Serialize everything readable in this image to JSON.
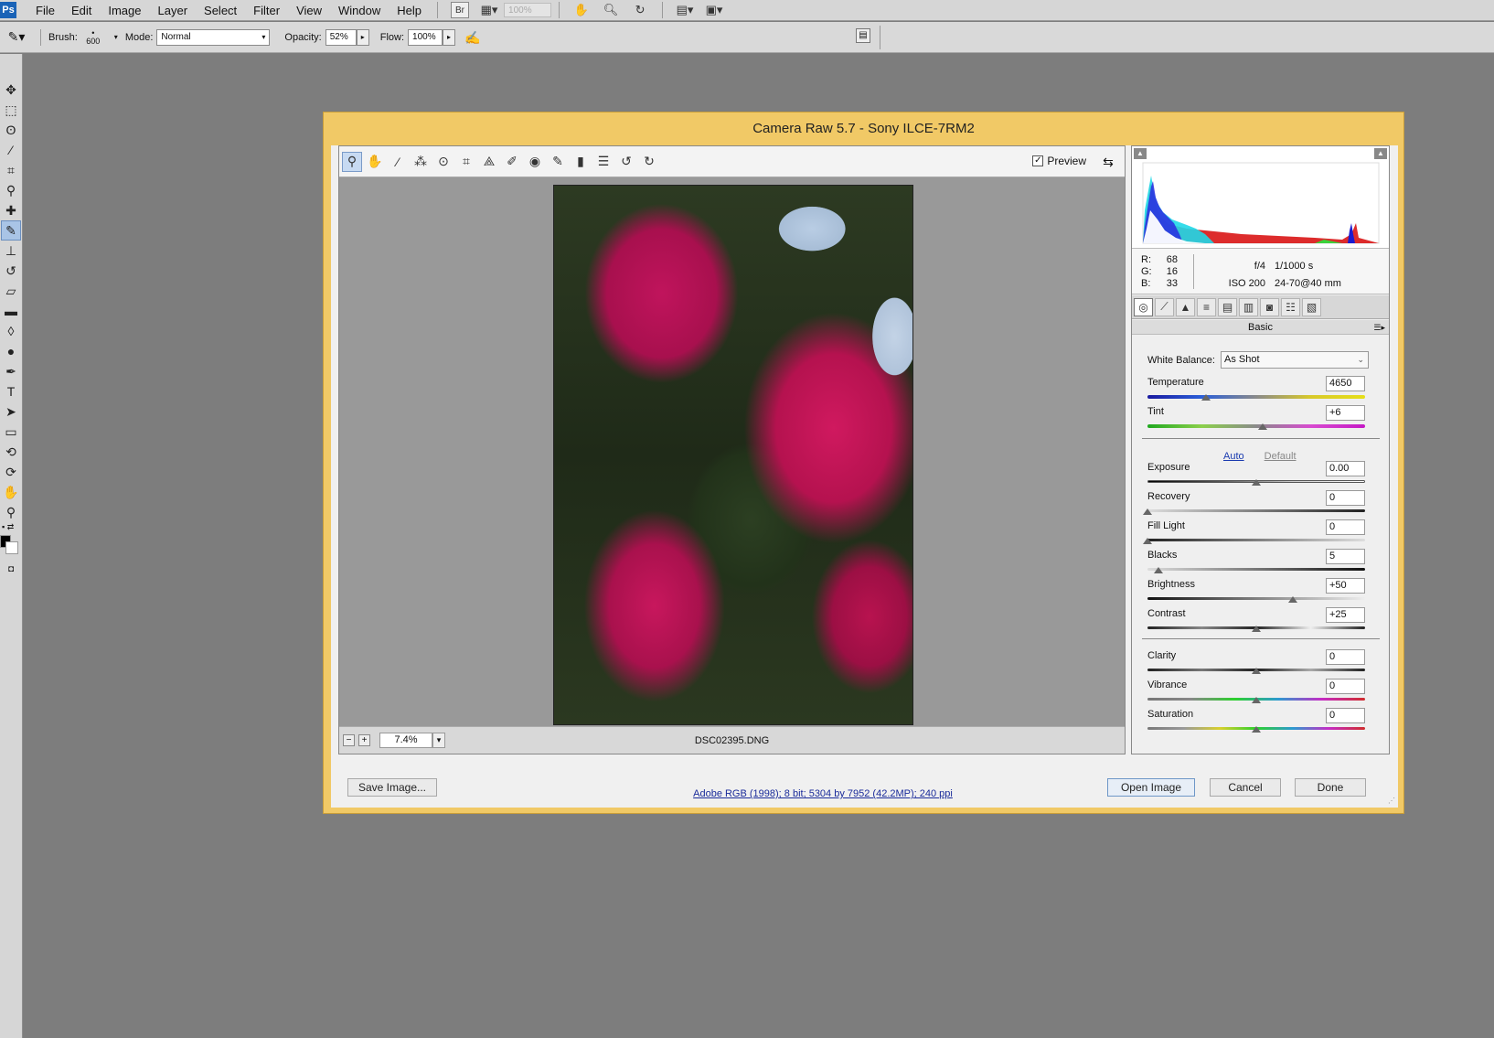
{
  "menubar": {
    "logo": "Ps",
    "items": [
      "File",
      "Edit",
      "Image",
      "Layer",
      "Select",
      "Filter",
      "View",
      "Window",
      "Help"
    ],
    "bridge": "Br",
    "zoom_placeholder": "100%"
  },
  "options_bar": {
    "brush_label": "Brush:",
    "brush_size": "600",
    "mode_label": "Mode:",
    "mode_value": "Normal",
    "opacity_label": "Opacity:",
    "opacity_value": "52%",
    "flow_label": "Flow:",
    "flow_value": "100%"
  },
  "left_tools": [
    "move-tool-icon",
    "marquee-tool-icon",
    "lasso-tool-icon",
    "magic-wand-icon",
    "crop-tool-icon",
    "eyedropper-icon",
    "healing-brush-icon",
    "brush-tool-icon",
    "clone-stamp-icon",
    "history-brush-icon",
    "eraser-icon",
    "gradient-icon",
    "blur-icon",
    "dodge-icon",
    "pen-tool-icon",
    "type-tool-icon",
    "path-select-icon",
    "shape-tool-icon",
    "3d-rotate-icon",
    "3d-orbit-icon",
    "hand-tool-icon",
    "zoom-tool-icon"
  ],
  "dialog": {
    "title": "Camera Raw 5.7  -  Sony ILCE-7RM2",
    "toolbar_icons": [
      "zoom-icon",
      "hand-icon",
      "white-balance-icon",
      "color-sampler-icon",
      "target-adjust-icon",
      "crop-icon",
      "straighten-icon",
      "spot-removal-icon",
      "red-eye-icon",
      "adjustment-brush-icon",
      "graduated-filter-icon",
      "preferences-icon",
      "rotate-ccw-icon",
      "rotate-cw-icon"
    ],
    "preview_label": "Preview",
    "preview_checked": true,
    "zoom_value": "7.4%",
    "filename": "DSC02395.DNG",
    "rgb": {
      "r_label": "R:",
      "r": "68",
      "g_label": "G:",
      "g": "16",
      "b_label": "B:",
      "b": "33"
    },
    "camera": {
      "aperture": "f/4",
      "shutter": "1/1000 s",
      "iso": "ISO 200",
      "lens": "24-70@40 mm"
    },
    "panel_title": "Basic",
    "white_balance_label": "White Balance:",
    "white_balance_value": "As Shot",
    "auto_label": "Auto",
    "default_label": "Default",
    "sliders": {
      "temperature": {
        "label": "Temperature",
        "value": "4650",
        "pos": 0.27
      },
      "tint": {
        "label": "Tint",
        "value": "+6",
        "pos": 0.53
      },
      "exposure": {
        "label": "Exposure",
        "value": "0.00",
        "pos": 0.5
      },
      "recovery": {
        "label": "Recovery",
        "value": "0",
        "pos": 0.0
      },
      "fill_light": {
        "label": "Fill Light",
        "value": "0",
        "pos": 0.0
      },
      "blacks": {
        "label": "Blacks",
        "value": "5",
        "pos": 0.05
      },
      "brightness": {
        "label": "Brightness",
        "value": "+50",
        "pos": 0.67
      },
      "contrast": {
        "label": "Contrast",
        "value": "+25",
        "pos": 0.5
      },
      "clarity": {
        "label": "Clarity",
        "value": "0",
        "pos": 0.5
      },
      "vibrance": {
        "label": "Vibrance",
        "value": "0",
        "pos": 0.5
      },
      "saturation": {
        "label": "Saturation",
        "value": "0",
        "pos": 0.5
      }
    },
    "buttons": {
      "save": "Save Image...",
      "open": "Open Image",
      "cancel": "Cancel",
      "done": "Done"
    },
    "workflow_link": "Adobe RGB (1998); 8 bit; 5304 by 7952 (42.2MP); 240 ppi"
  }
}
